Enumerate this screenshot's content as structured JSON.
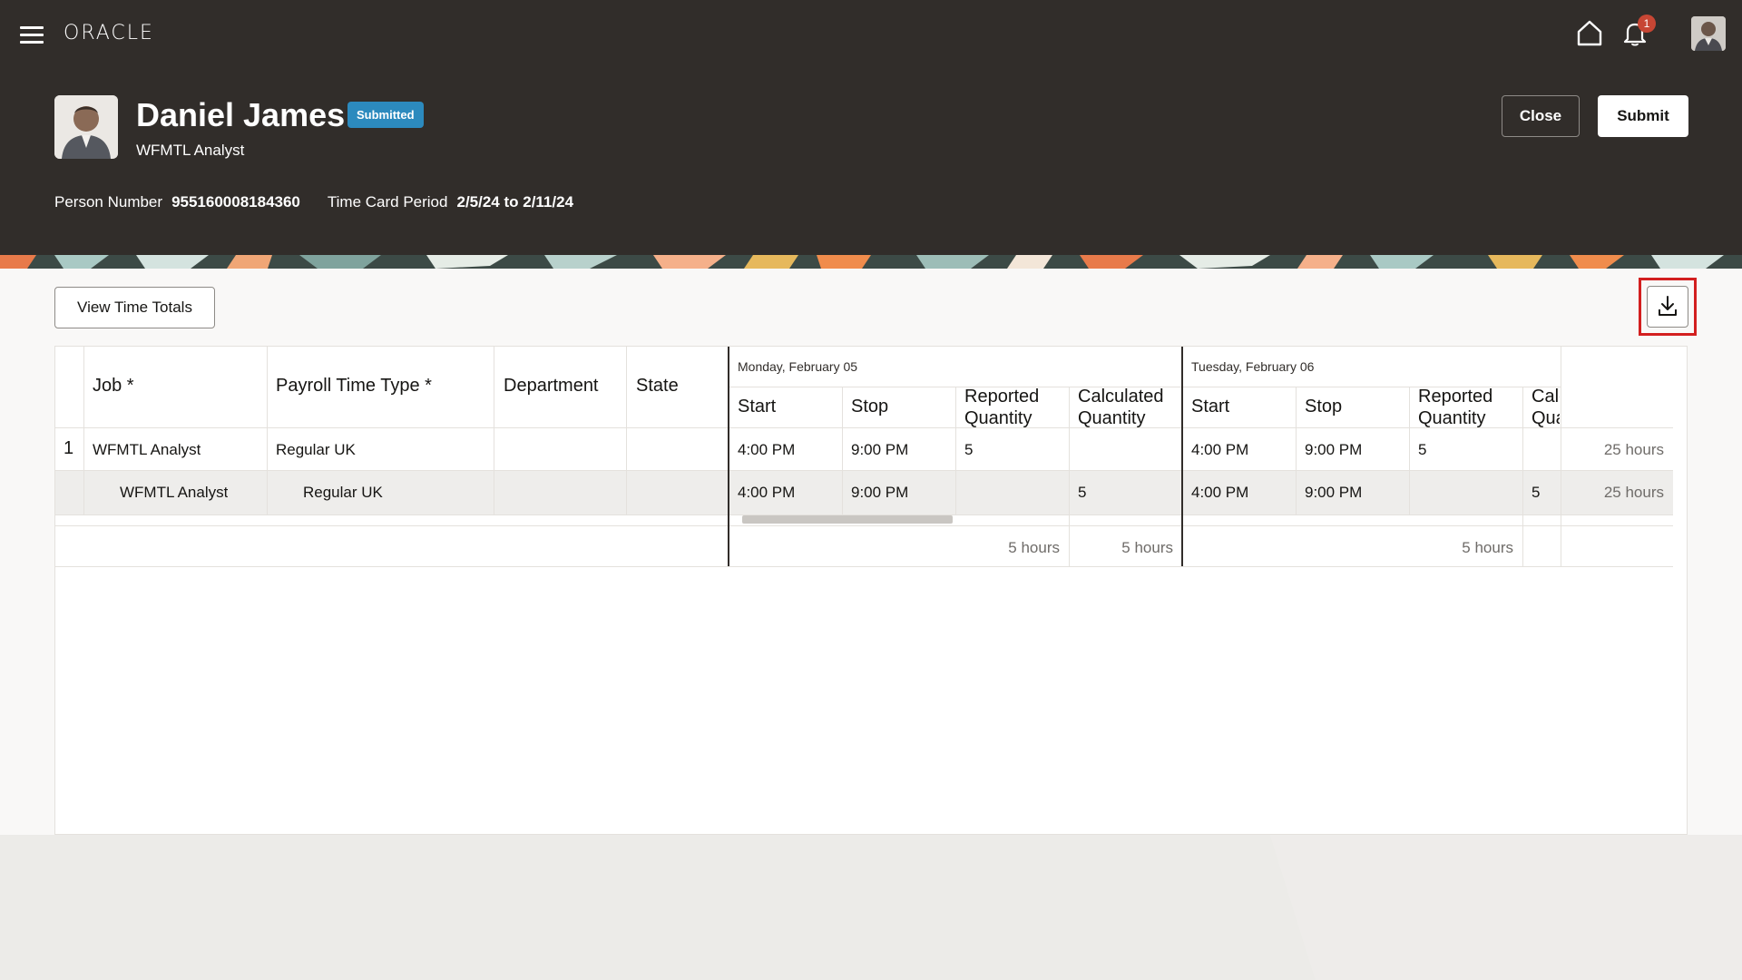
{
  "header": {
    "logo": "ORACLE",
    "notification_count": "1",
    "employee_name": "Daniel James",
    "status": "Submitted",
    "employee_title": "WFMTL Analyst",
    "person_number_label": "Person Number",
    "person_number": "955160008184360",
    "period_label": "Time Card Period",
    "period": "2/5/24 to 2/11/24",
    "close_label": "Close",
    "submit_label": "Submit"
  },
  "toolbar": {
    "view_totals_label": "View Time Totals"
  },
  "grid": {
    "columns": {
      "job": "Job *",
      "payroll": "Payroll Time Type *",
      "department": "Department",
      "state": "State"
    },
    "days": [
      {
        "date": "Monday, February 05",
        "start": "Start",
        "stop": "Stop",
        "reported": "Reported Quantity",
        "calculated": "Calculated Quantity"
      },
      {
        "date": "Tuesday, February 06",
        "start": "Start",
        "stop": "Stop",
        "reported": "Reported Quantity",
        "calculated": "Calculated Quantity"
      }
    ],
    "rows": [
      {
        "num": "1",
        "job": "WFMTL Analyst",
        "payroll": "Regular UK",
        "department": "",
        "state": "",
        "mon_start": "4:00 PM",
        "mon_stop": "9:00 PM",
        "mon_reported": "5",
        "mon_calculated": "",
        "tue_start": "4:00 PM",
        "tue_stop": "9:00 PM",
        "tue_reported": "5",
        "tue_calculated": "",
        "total": "25 hours"
      },
      {
        "num": "",
        "job": "WFMTL Analyst",
        "payroll": "Regular UK",
        "department": "",
        "state": "",
        "mon_start": "4:00 PM",
        "mon_stop": "9:00 PM",
        "mon_reported": "",
        "mon_calculated": "5",
        "tue_start": "4:00 PM",
        "tue_stop": "9:00 PM",
        "tue_reported": "",
        "tue_calculated": "5",
        "total": "25 hours"
      }
    ],
    "totals": {
      "mon_reported": "5 hours",
      "mon_calculated": "5 hours",
      "tue_reported": "5 hours"
    }
  },
  "colors": {
    "header_bg": "#312d2a",
    "badge": "#2c8abe",
    "notification": "#c74634",
    "highlight": "#d31f1f"
  }
}
